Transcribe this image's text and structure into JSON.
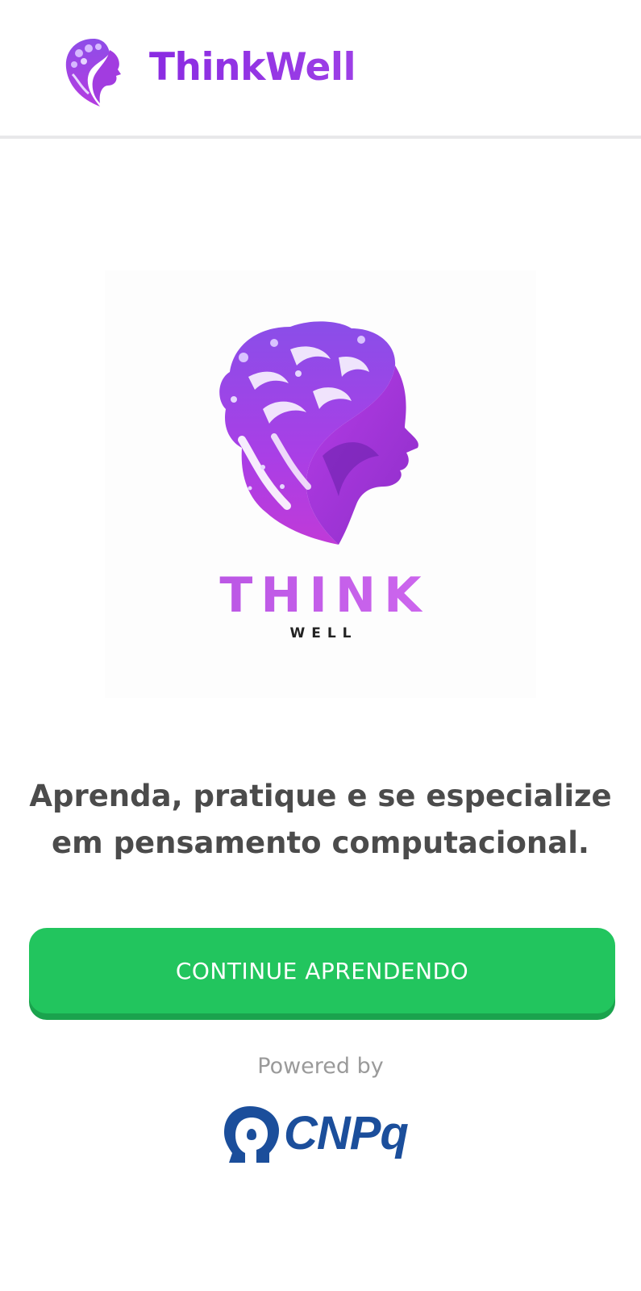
{
  "header": {
    "app_name": "ThinkWell",
    "logo_icon": "brain-head-logo-icon"
  },
  "hero": {
    "logo_icon": "brain-head-logo-icon",
    "logo_title": "THINK",
    "logo_subtitle": "WELL"
  },
  "main": {
    "tagline": "Aprenda, pratique e se especialize em pensamento computacional.",
    "cta_label": "CONTINUE APRENDENDO"
  },
  "footer": {
    "powered_by": "Powered by",
    "sponsor_icon": "cnpq-head-icon",
    "sponsor_name": "CNPq"
  },
  "colors": {
    "brand_purple": "#8a2be2",
    "cta_green": "#22c55e",
    "sponsor_blue": "#1b4e9b"
  }
}
